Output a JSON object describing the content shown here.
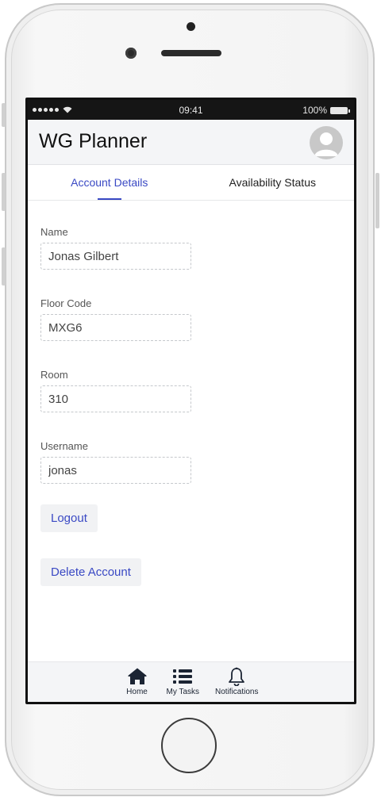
{
  "status_bar": {
    "time": "09:41",
    "battery": "100%",
    "icons": [
      "signal-icon",
      "wifi-icon",
      "battery-icon"
    ]
  },
  "app_bar": {
    "title": "WG Planner",
    "avatar_icon": "user-avatar-icon"
  },
  "tabs": [
    {
      "label": "Account Details",
      "active": true
    },
    {
      "label": "Availability Status",
      "active": false
    }
  ],
  "form": {
    "name": {
      "label": "Name",
      "value": "Jonas Gilbert"
    },
    "floor_code": {
      "label": "Floor Code",
      "value": "MXG6"
    },
    "room": {
      "label": "Room",
      "value": "310"
    },
    "username": {
      "label": "Username",
      "value": "jonas"
    }
  },
  "actions": {
    "logout_label": "Logout",
    "delete_label": "Delete Account"
  },
  "bottom_nav": [
    {
      "label": "Home",
      "icon": "home-icon"
    },
    {
      "label": "My Tasks",
      "icon": "list-icon"
    },
    {
      "label": "Notifications",
      "icon": "bell-icon"
    }
  ],
  "colors": {
    "accent": "#3a49c4",
    "appbar_bg": "#f4f5f7",
    "button_bg": "#f1f2f4",
    "nav_icon": "#1b2433"
  }
}
